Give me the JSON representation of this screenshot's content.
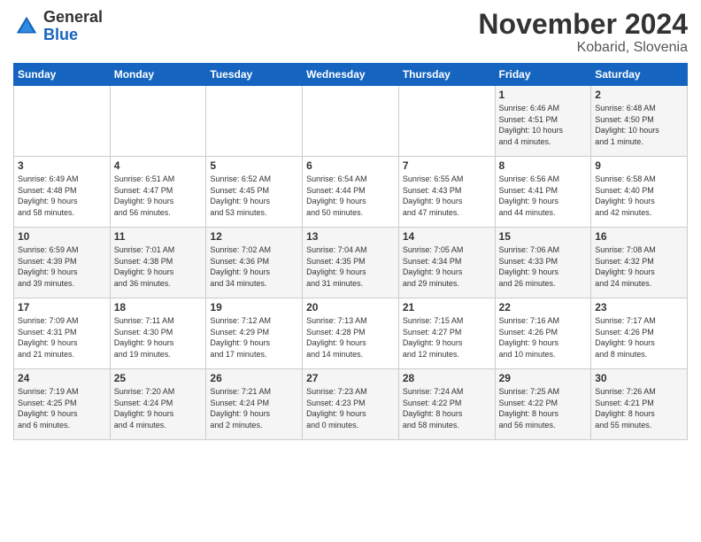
{
  "logo": {
    "general": "General",
    "blue": "Blue"
  },
  "header": {
    "month": "November 2024",
    "location": "Kobarid, Slovenia"
  },
  "weekdays": [
    "Sunday",
    "Monday",
    "Tuesday",
    "Wednesday",
    "Thursday",
    "Friday",
    "Saturday"
  ],
  "weeks": [
    [
      {
        "day": "",
        "info": ""
      },
      {
        "day": "",
        "info": ""
      },
      {
        "day": "",
        "info": ""
      },
      {
        "day": "",
        "info": ""
      },
      {
        "day": "",
        "info": ""
      },
      {
        "day": "1",
        "info": "Sunrise: 6:46 AM\nSunset: 4:51 PM\nDaylight: 10 hours\nand 4 minutes."
      },
      {
        "day": "2",
        "info": "Sunrise: 6:48 AM\nSunset: 4:50 PM\nDaylight: 10 hours\nand 1 minute."
      }
    ],
    [
      {
        "day": "3",
        "info": "Sunrise: 6:49 AM\nSunset: 4:48 PM\nDaylight: 9 hours\nand 58 minutes."
      },
      {
        "day": "4",
        "info": "Sunrise: 6:51 AM\nSunset: 4:47 PM\nDaylight: 9 hours\nand 56 minutes."
      },
      {
        "day": "5",
        "info": "Sunrise: 6:52 AM\nSunset: 4:45 PM\nDaylight: 9 hours\nand 53 minutes."
      },
      {
        "day": "6",
        "info": "Sunrise: 6:54 AM\nSunset: 4:44 PM\nDaylight: 9 hours\nand 50 minutes."
      },
      {
        "day": "7",
        "info": "Sunrise: 6:55 AM\nSunset: 4:43 PM\nDaylight: 9 hours\nand 47 minutes."
      },
      {
        "day": "8",
        "info": "Sunrise: 6:56 AM\nSunset: 4:41 PM\nDaylight: 9 hours\nand 44 minutes."
      },
      {
        "day": "9",
        "info": "Sunrise: 6:58 AM\nSunset: 4:40 PM\nDaylight: 9 hours\nand 42 minutes."
      }
    ],
    [
      {
        "day": "10",
        "info": "Sunrise: 6:59 AM\nSunset: 4:39 PM\nDaylight: 9 hours\nand 39 minutes."
      },
      {
        "day": "11",
        "info": "Sunrise: 7:01 AM\nSunset: 4:38 PM\nDaylight: 9 hours\nand 36 minutes."
      },
      {
        "day": "12",
        "info": "Sunrise: 7:02 AM\nSunset: 4:36 PM\nDaylight: 9 hours\nand 34 minutes."
      },
      {
        "day": "13",
        "info": "Sunrise: 7:04 AM\nSunset: 4:35 PM\nDaylight: 9 hours\nand 31 minutes."
      },
      {
        "day": "14",
        "info": "Sunrise: 7:05 AM\nSunset: 4:34 PM\nDaylight: 9 hours\nand 29 minutes."
      },
      {
        "day": "15",
        "info": "Sunrise: 7:06 AM\nSunset: 4:33 PM\nDaylight: 9 hours\nand 26 minutes."
      },
      {
        "day": "16",
        "info": "Sunrise: 7:08 AM\nSunset: 4:32 PM\nDaylight: 9 hours\nand 24 minutes."
      }
    ],
    [
      {
        "day": "17",
        "info": "Sunrise: 7:09 AM\nSunset: 4:31 PM\nDaylight: 9 hours\nand 21 minutes."
      },
      {
        "day": "18",
        "info": "Sunrise: 7:11 AM\nSunset: 4:30 PM\nDaylight: 9 hours\nand 19 minutes."
      },
      {
        "day": "19",
        "info": "Sunrise: 7:12 AM\nSunset: 4:29 PM\nDaylight: 9 hours\nand 17 minutes."
      },
      {
        "day": "20",
        "info": "Sunrise: 7:13 AM\nSunset: 4:28 PM\nDaylight: 9 hours\nand 14 minutes."
      },
      {
        "day": "21",
        "info": "Sunrise: 7:15 AM\nSunset: 4:27 PM\nDaylight: 9 hours\nand 12 minutes."
      },
      {
        "day": "22",
        "info": "Sunrise: 7:16 AM\nSunset: 4:26 PM\nDaylight: 9 hours\nand 10 minutes."
      },
      {
        "day": "23",
        "info": "Sunrise: 7:17 AM\nSunset: 4:26 PM\nDaylight: 9 hours\nand 8 minutes."
      }
    ],
    [
      {
        "day": "24",
        "info": "Sunrise: 7:19 AM\nSunset: 4:25 PM\nDaylight: 9 hours\nand 6 minutes."
      },
      {
        "day": "25",
        "info": "Sunrise: 7:20 AM\nSunset: 4:24 PM\nDaylight: 9 hours\nand 4 minutes."
      },
      {
        "day": "26",
        "info": "Sunrise: 7:21 AM\nSunset: 4:24 PM\nDaylight: 9 hours\nand 2 minutes."
      },
      {
        "day": "27",
        "info": "Sunrise: 7:23 AM\nSunset: 4:23 PM\nDaylight: 9 hours\nand 0 minutes."
      },
      {
        "day": "28",
        "info": "Sunrise: 7:24 AM\nSunset: 4:22 PM\nDaylight: 8 hours\nand 58 minutes."
      },
      {
        "day": "29",
        "info": "Sunrise: 7:25 AM\nSunset: 4:22 PM\nDaylight: 8 hours\nand 56 minutes."
      },
      {
        "day": "30",
        "info": "Sunrise: 7:26 AM\nSunset: 4:21 PM\nDaylight: 8 hours\nand 55 minutes."
      }
    ]
  ]
}
